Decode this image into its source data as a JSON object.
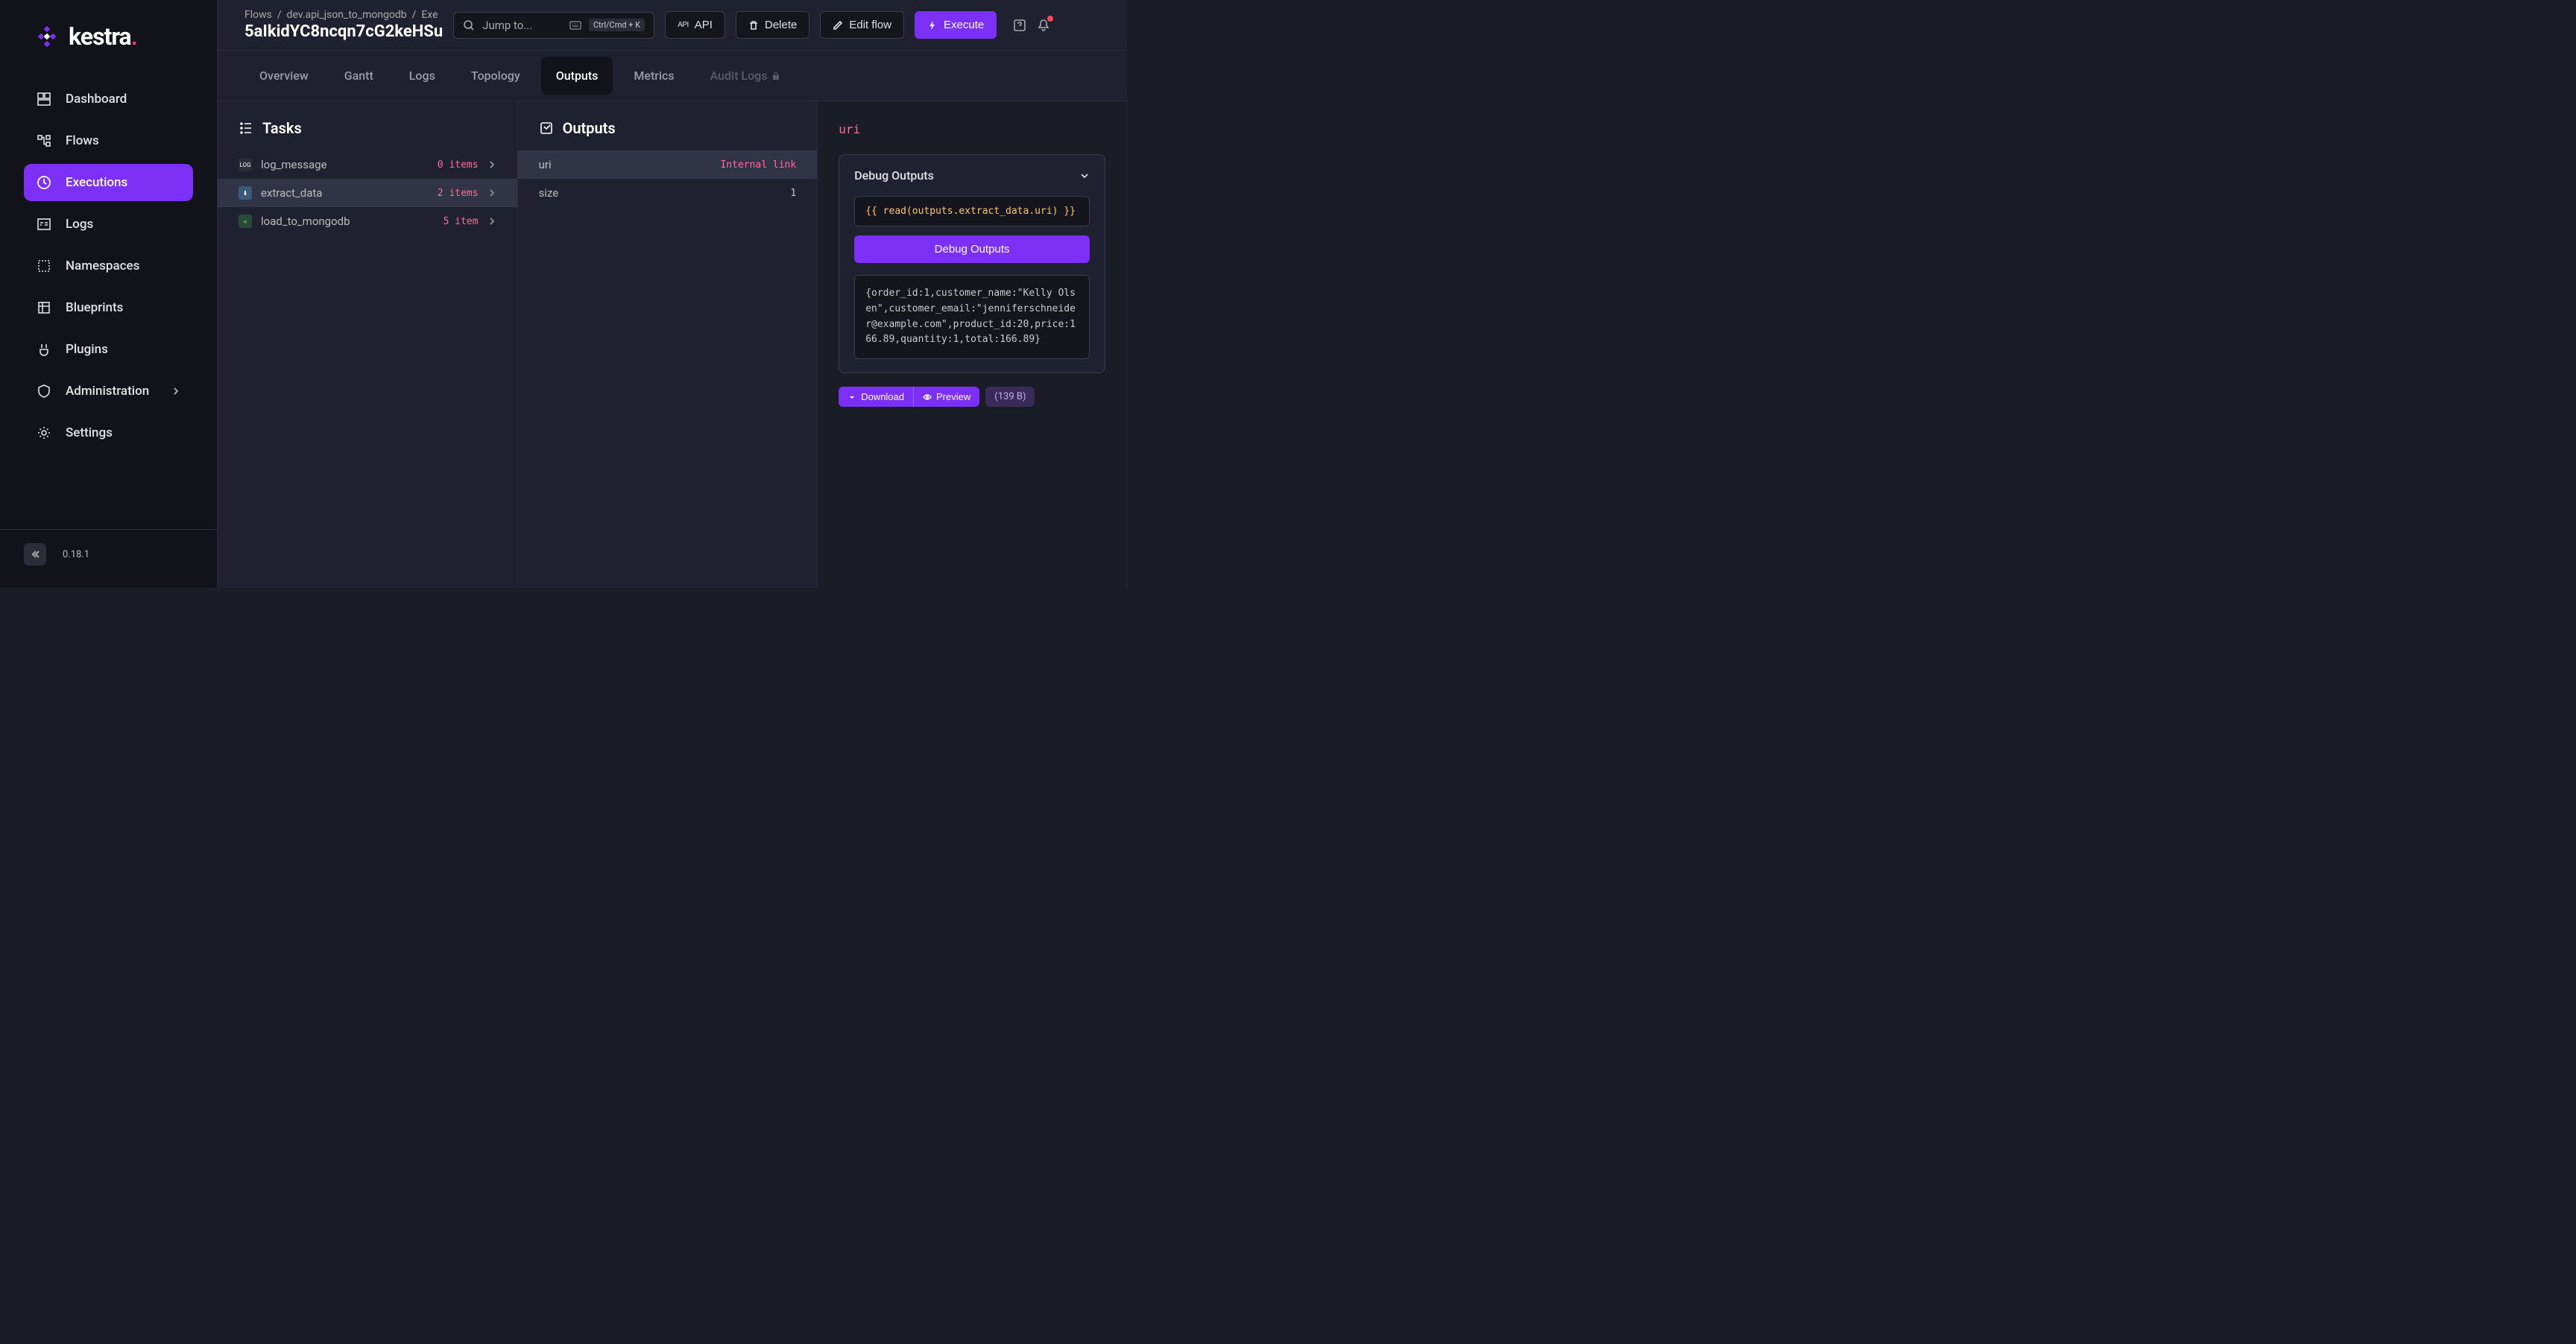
{
  "logo": {
    "text": "kestra"
  },
  "sidebar": {
    "items": [
      {
        "label": "Dashboard",
        "icon": "dashboard"
      },
      {
        "label": "Flows",
        "icon": "flows"
      },
      {
        "label": "Executions",
        "icon": "executions",
        "active": true
      },
      {
        "label": "Logs",
        "icon": "logs"
      },
      {
        "label": "Namespaces",
        "icon": "namespaces"
      },
      {
        "label": "Blueprints",
        "icon": "blueprints"
      },
      {
        "label": "Plugins",
        "icon": "plugins"
      },
      {
        "label": "Administration",
        "icon": "admin",
        "chevron": true
      },
      {
        "label": "Settings",
        "icon": "settings"
      }
    ],
    "version": "0.18.1"
  },
  "breadcrumb": {
    "part1": "Flows",
    "part2": "dev.api_json_to_mongodb",
    "part3": "Exe",
    "execution_id": "5aIkidYC8ncqn7cG2keHSu"
  },
  "search": {
    "placeholder": "Jump to...",
    "kbd": "Ctrl/Cmd + K"
  },
  "topbar": {
    "api_label": "API",
    "delete_label": "Delete",
    "edit_label": "Edit flow",
    "execute_label": "Execute"
  },
  "tabs": [
    {
      "label": "Overview"
    },
    {
      "label": "Gantt"
    },
    {
      "label": "Logs"
    },
    {
      "label": "Topology"
    },
    {
      "label": "Outputs",
      "active": true
    },
    {
      "label": "Metrics"
    },
    {
      "label": "Audit Logs",
      "disabled": true
    }
  ],
  "tasks": {
    "header": "Tasks",
    "items": [
      {
        "icon": "LOG",
        "name": "log_message",
        "badge": "0 items"
      },
      {
        "icon": "EX",
        "name": "extract_data",
        "badge": "2 items",
        "selected": true
      },
      {
        "icon": "MG",
        "name": "load_to_mongodb",
        "badge": "5 item"
      }
    ]
  },
  "outputs": {
    "header": "Outputs",
    "items": [
      {
        "name": "uri",
        "value": "Internal link",
        "pink": true,
        "selected": true
      },
      {
        "name": "size",
        "value": "1"
      }
    ]
  },
  "detail": {
    "key": "uri",
    "debug_header": "Debug Outputs",
    "expression": "{{ read(outputs.extract_data.uri) }}",
    "debug_button": "Debug Outputs",
    "result": "{order_id:1,customer_name:\"Kelly Olsen\",customer_email:\"jenniferschneider@example.com\",product_id:20,price:166.89,quantity:1,total:166.89}",
    "download_label": "Download",
    "preview_label": "Preview",
    "size_label": "(139 B)"
  }
}
